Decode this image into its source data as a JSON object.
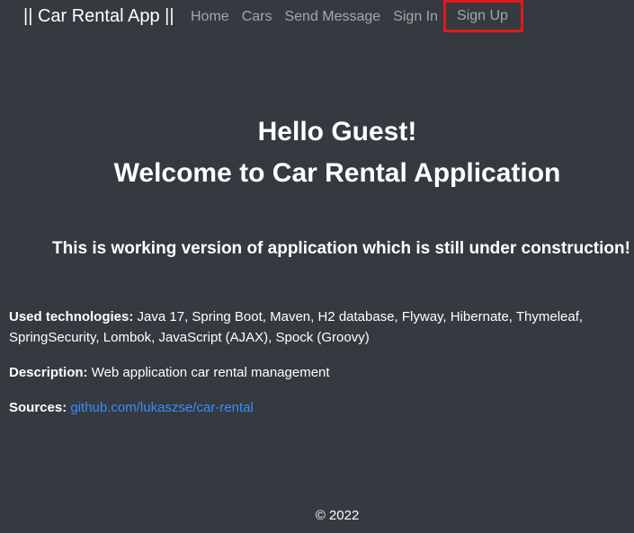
{
  "navbar": {
    "brand": "|| Car Rental App ||",
    "links": [
      "Home",
      "Cars",
      "Send Message",
      "Sign In",
      "Sign Up"
    ],
    "highlight_color": "#e01a1a"
  },
  "hero": {
    "greeting": "Hello Guest!",
    "welcome": "Welcome to Car Rental Application"
  },
  "subtitle": "This is working version of application which is still under construction!",
  "info": {
    "technologies_label": "Used technologies:",
    "technologies_value": "Java 17, Spring Boot, Maven, H2 database, Flyway, Hibernate, Thymeleaf, SpringSecurity, Lombok, JavaScript (AJAX), Spock (Groovy)",
    "description_label": "Description:",
    "description_value": "Web application car rental management",
    "sources_label": "Sources:",
    "sources_link": "github.com/lukaszse/car-rental"
  },
  "footer": "© 2022",
  "colors": {
    "background": "#343a40",
    "link": "#3d8bfd",
    "nav_muted": "rgba(255,255,255,0.55)"
  }
}
